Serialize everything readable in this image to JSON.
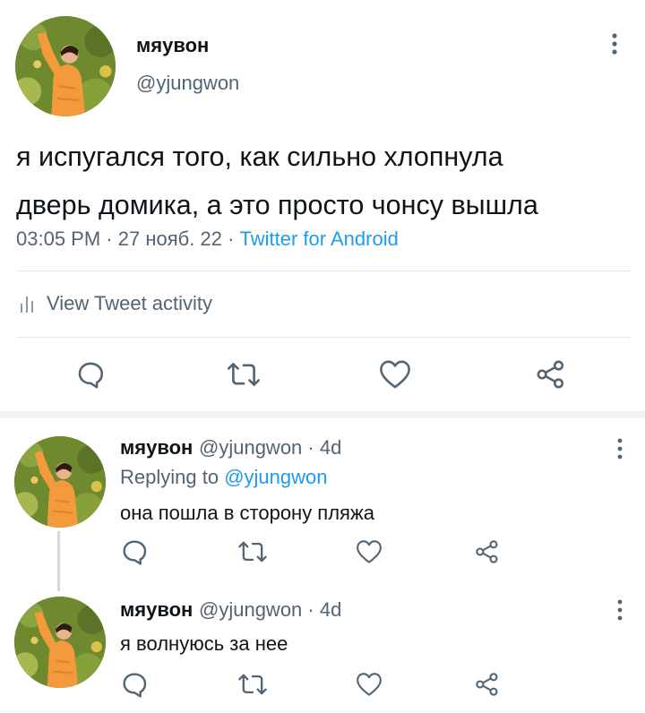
{
  "main_tweet": {
    "display_name": "мяувон",
    "handle": "@yjungwon",
    "text_line1": "я испугался того, как сильно хлопнула",
    "text_line2": "дверь домика, а это просто чонсу вышла",
    "time": "03:05 PM",
    "date": "27 нояб. 22",
    "source": "Twitter for Android",
    "activity_label": "View Tweet activity"
  },
  "replies": [
    {
      "display_name": "мяувон",
      "handle": "@yjungwon",
      "age": "4d",
      "replying_prefix": "Replying to",
      "replying_to": "@yjungwon",
      "text": "она пошла в сторону пляжа"
    },
    {
      "display_name": "мяувон",
      "handle": "@yjungwon",
      "age": "4d",
      "text": "я волнуюсь за нее"
    }
  ],
  "colors": {
    "text": "#0f1419",
    "secondary": "#536471",
    "link": "#1d9bf0",
    "divider": "#e6e9ec",
    "avatar_orange": "#f39a3c",
    "avatar_green": "#6f8a2e"
  },
  "icons": [
    "more-vertical-icon",
    "bar-chart-icon",
    "reply-icon",
    "retweet-icon",
    "like-icon",
    "share-icon"
  ]
}
